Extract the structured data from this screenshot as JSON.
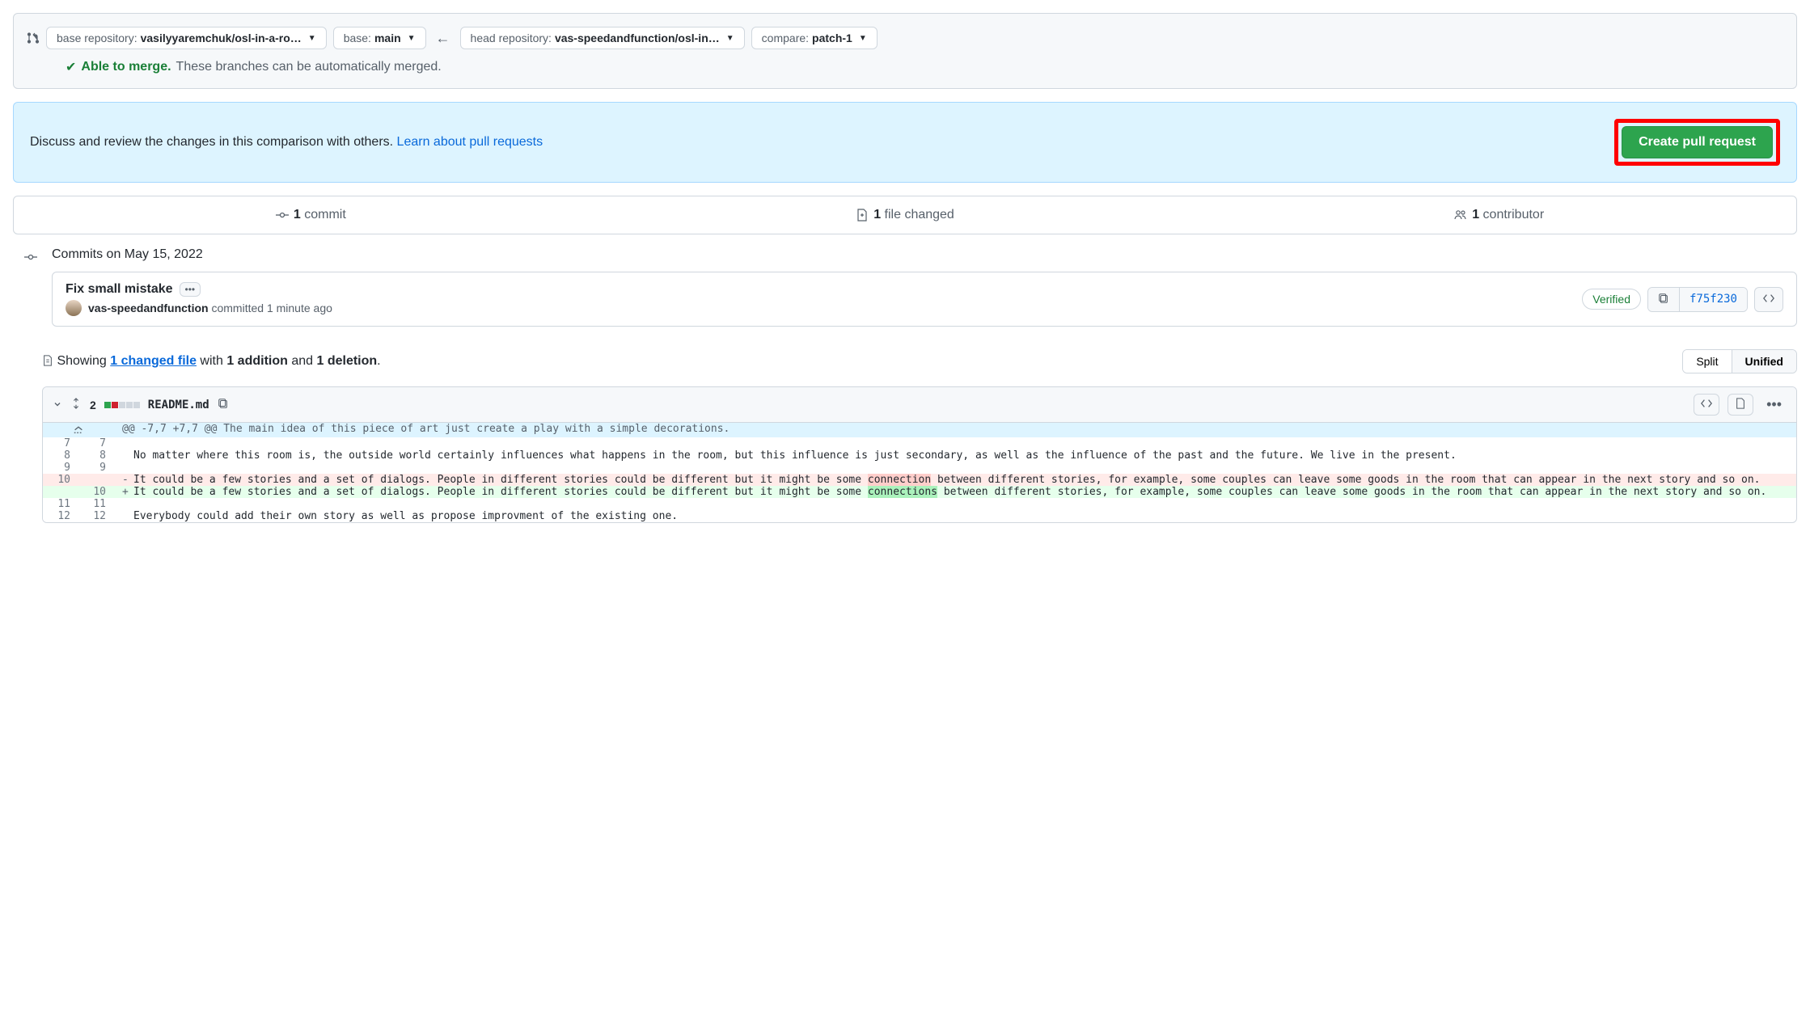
{
  "compare": {
    "base_repo_label": "base repository: ",
    "base_repo_value": "vasilyyaremchuk/osl-in-a-ro…",
    "base_branch_label": "base: ",
    "base_branch_value": "main",
    "head_repo_label": "head repository: ",
    "head_repo_value": "vas-speedandfunction/osl-in…",
    "compare_label": "compare: ",
    "compare_value": "patch-1"
  },
  "merge": {
    "able": "Able to merge.",
    "desc": "These branches can be automatically merged."
  },
  "discuss": {
    "text": "Discuss and review the changes in this comparison with others. ",
    "link": "Learn about pull requests",
    "button": "Create pull request"
  },
  "stats": {
    "commits_n": "1",
    "commits_word": " commit",
    "files_n": "1",
    "files_word": " file changed",
    "contrib_n": "1",
    "contrib_word": " contributor"
  },
  "commits_header": "Commits on May 15, 2022",
  "commit": {
    "title": "Fix small mistake",
    "author": "vas-speedandfunction",
    "meta_rest": " committed 1 minute ago",
    "verified": "Verified",
    "sha": "f75f230"
  },
  "diff_summary": {
    "showing": "Showing ",
    "changed_file": "1 changed file",
    "with": " with ",
    "additions": "1 addition",
    "and": " and ",
    "deletions": "1 deletion",
    "period": ".",
    "split": "Split",
    "unified": "Unified"
  },
  "file": {
    "change_count": "2",
    "name": "README.md"
  },
  "hunk": "@@ -7,7 +7,7 @@ The main idea of this piece of art just create a play with a simple decorations.",
  "lines": {
    "l7": "",
    "l8": "No matter where this room is, the outside world certainly influences what happens in the room, but this influence is just secondary, as well as the influence of the past and the future. We live in the present.",
    "l9": "",
    "del_pre": "It could be a few stories and a set of dialogs. People in different stories could be different but it might be some ",
    "del_hl": "connection",
    "del_post": " between different stories, for example, some couples can leave some goods in the room that can appear in the next story and so on.",
    "add_pre": "It could be a few stories and a set of dialogs. People in different stories could be different but it might be some ",
    "add_hl": "connections",
    "add_post": " between different stories, for example, some couples can leave some goods in the room that can appear in the next story and so on.",
    "l11": "",
    "l12": "Everybody could add their own story as well as propose improvment of the existing one."
  },
  "ln": {
    "o7": "7",
    "n7": "7",
    "o8": "8",
    "n8": "8",
    "o9": "9",
    "n9": "9",
    "o10": "10",
    "n10": "10",
    "o11": "11",
    "n11": "11",
    "o12": "12",
    "n12": "12"
  }
}
